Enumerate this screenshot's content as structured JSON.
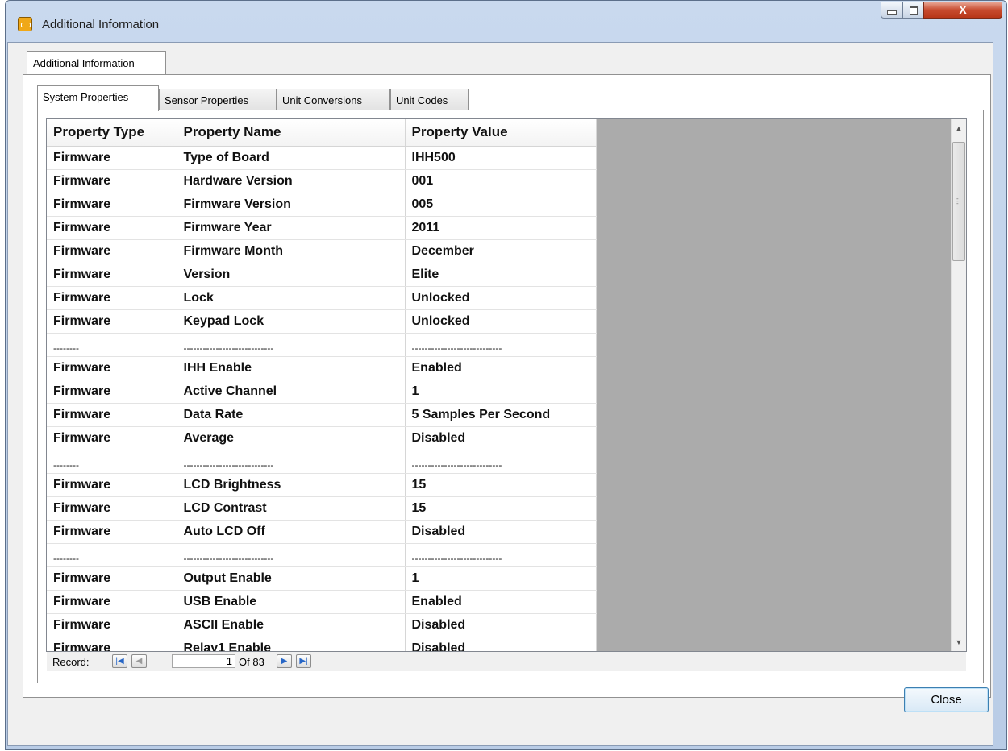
{
  "window": {
    "title": "Additional Information",
    "minimize_label": "",
    "maximize_label": "",
    "close_label": "X"
  },
  "outer_tab": {
    "label": "Additional Information"
  },
  "inner_tabs": [
    {
      "label": "System Properties",
      "active": true
    },
    {
      "label": "Sensor Properties",
      "active": false
    },
    {
      "label": "Unit Conversions",
      "active": false
    },
    {
      "label": "Unit Codes",
      "active": false
    }
  ],
  "grid": {
    "columns": [
      "Property Type",
      "Property Name",
      "Property Value"
    ],
    "rows": [
      [
        "Firmware",
        "Type of Board",
        "IHH500"
      ],
      [
        "Firmware",
        "Hardware Version",
        "001"
      ],
      [
        "Firmware",
        "Firmware Version",
        "005"
      ],
      [
        "Firmware",
        "Firmware Year",
        "2011"
      ],
      [
        "Firmware",
        "Firmware Month",
        "December"
      ],
      [
        "Firmware",
        "Version",
        "Elite"
      ],
      [
        "Firmware",
        "Lock",
        "Unlocked"
      ],
      [
        "Firmware",
        "Keypad Lock",
        "Unlocked"
      ],
      [
        "--------",
        "----------------------------",
        "----------------------------"
      ],
      [
        "Firmware",
        "IHH Enable",
        "Enabled"
      ],
      [
        "Firmware",
        "Active Channel",
        "1"
      ],
      [
        "Firmware",
        "Data Rate",
        "5 Samples Per Second"
      ],
      [
        "Firmware",
        "Average",
        "Disabled"
      ],
      [
        "--------",
        "----------------------------",
        "----------------------------"
      ],
      [
        "Firmware",
        "LCD Brightness",
        "15"
      ],
      [
        "Firmware",
        "LCD Contrast",
        "15"
      ],
      [
        "Firmware",
        "Auto LCD Off",
        "Disabled"
      ],
      [
        "--------",
        "----------------------------",
        "----------------------------"
      ],
      [
        "Firmware",
        "Output Enable",
        "1"
      ],
      [
        "Firmware",
        "USB Enable",
        "Enabled"
      ],
      [
        "Firmware",
        "ASCII Enable",
        "Disabled"
      ],
      [
        "Firmware",
        "Relay1 Enable",
        "Disabled"
      ]
    ]
  },
  "navigator": {
    "label": "Record:",
    "current": "1",
    "of_text": "Of  83"
  },
  "close_button": {
    "label": "Close"
  },
  "icons": {
    "first": "first-record-icon",
    "prev": "previous-record-icon",
    "next": "next-record-icon",
    "last": "last-record-icon"
  }
}
